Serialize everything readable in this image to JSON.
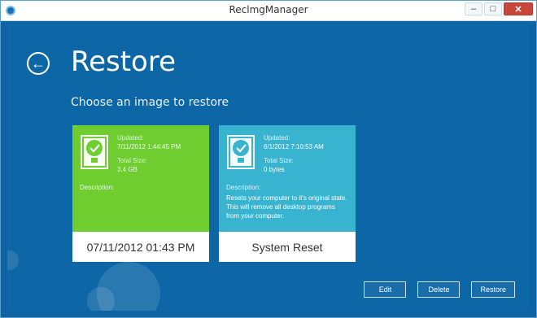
{
  "window": {
    "title": "ReclmgManager"
  },
  "window_controls": {
    "minimize": "–",
    "maximize": "□",
    "close": "✕"
  },
  "header": {
    "back_glyph": "←",
    "title": "Restore",
    "subtitle": "Choose an image to restore"
  },
  "images": [
    {
      "updated_label": "Updated:",
      "updated_value": "7/11/2012 1:44:45 PM",
      "size_label": "Total Size:",
      "size_value": "3.4 GB",
      "description_label": "Description:",
      "description_value": "",
      "footer_label": "07/11/2012 01:43 PM",
      "color": "#6fcd2f"
    },
    {
      "updated_label": "Updated:",
      "updated_value": "6/1/2012 7:10:53 AM",
      "size_label": "Total Size:",
      "size_value": "0 bytes",
      "description_label": "Description:",
      "description_value": "Resets your computer to it's original state. This will remove all desktop programs from your computer.",
      "footer_label": "System Reset",
      "color": "#38b3d0"
    }
  ],
  "actions": {
    "edit": "Edit",
    "delete": "Delete",
    "restore": "Restore"
  },
  "icons": {
    "app": "app-icon",
    "back": "back-arrow-icon",
    "disk": "disk-check-icon"
  }
}
